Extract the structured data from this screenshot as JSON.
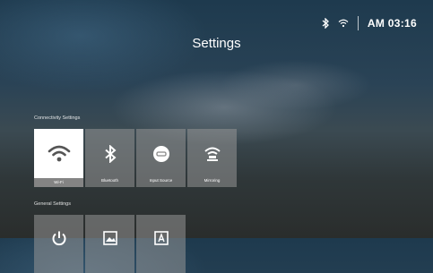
{
  "status_bar": {
    "bluetooth_icon": "bluetooth-icon",
    "wifi_icon": "wifi-icon",
    "time": "AM 03:16"
  },
  "page": {
    "title": "Settings"
  },
  "connectivity": {
    "label": "Connectivity Settings",
    "tiles": [
      {
        "label": "Wi-Fi",
        "icon": "wifi-icon",
        "selected": true
      },
      {
        "label": "Bluetooth",
        "icon": "bluetooth-icon",
        "selected": false
      },
      {
        "label": "Input Source",
        "icon": "input-source-icon",
        "selected": false
      },
      {
        "label": "Mirroring",
        "icon": "mirroring-icon",
        "selected": false
      }
    ]
  },
  "general": {
    "label": "General Settings",
    "tiles": [
      {
        "icon": "power-icon"
      },
      {
        "icon": "image-icon"
      },
      {
        "icon": "text-icon"
      }
    ]
  },
  "colors": {
    "selected_tile": "#ffffff",
    "tile": "#969696"
  }
}
